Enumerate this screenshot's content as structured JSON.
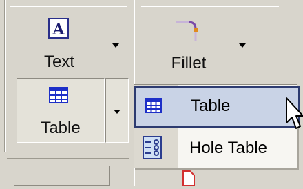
{
  "toolbar": {
    "text_button": {
      "label": "Text",
      "icon": "text-annotation-icon"
    },
    "fillet_button": {
      "label": "Fillet",
      "icon": "fillet-icon"
    },
    "table_button": {
      "label": "Table",
      "icon": "table-icon"
    }
  },
  "flyout_menu": {
    "items": [
      {
        "label": "Table",
        "icon": "table-icon",
        "highlighted": true
      },
      {
        "label": "Hole Table",
        "icon": "hole-table-icon",
        "highlighted": false
      }
    ]
  },
  "colors": {
    "panel": "#d8d5cc",
    "menu_highlight": "#c9d3e6",
    "menu_highlight_border": "#2d3b70",
    "table_icon_blue": "#1d2fc8",
    "fillet_orange": "#e08a1e",
    "fillet_purple": "#7a4aa8"
  }
}
